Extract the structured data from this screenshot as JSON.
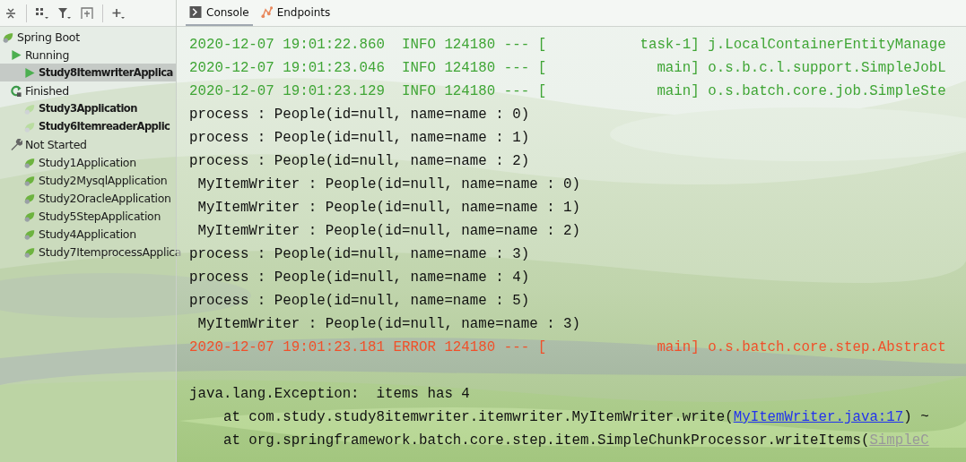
{
  "tree": {
    "label": "Spring Boot",
    "children": [
      {
        "label": "Running",
        "kind": "running",
        "children": [
          {
            "label": "Study8ItemwriterApplica",
            "bold": true,
            "selected": true
          }
        ]
      },
      {
        "label": "Finished",
        "kind": "finished",
        "children": [
          {
            "label": "Study3Application",
            "bold": true,
            "selected": false
          },
          {
            "label": "Study6ItemreaderApplic",
            "bold": true,
            "selected": false
          }
        ]
      },
      {
        "label": "Not Started",
        "kind": "not_started",
        "children": [
          {
            "label": "Study1Application",
            "bold": false,
            "selected": false
          },
          {
            "label": "Study2MysqlApplication",
            "bold": false,
            "selected": false
          },
          {
            "label": "Study2OracleApplication",
            "bold": false,
            "selected": false
          },
          {
            "label": "Study5StepApplication",
            "bold": false,
            "selected": false
          },
          {
            "label": "Study4Application",
            "bold": false,
            "selected": false
          },
          {
            "label": "Study7ItemprocessApplica",
            "bold": false,
            "selected": false
          }
        ]
      }
    ]
  },
  "tabs": [
    {
      "label": "Console",
      "kind": "console",
      "selected": true
    },
    {
      "label": "Endpoints",
      "kind": "endpoints",
      "selected": false
    }
  ],
  "console": [
    {
      "segments": [
        {
          "kind": "info",
          "text": "2020-12-07 19:01:22.860  INFO 124180 --- [           task-1] j.LocalContainerEntityManage"
        }
      ]
    },
    {
      "segments": [
        {
          "kind": "info",
          "text": "2020-12-07 19:01:23.046  INFO 124180 --- [             main] o.s.b.c.l.support.SimpleJobL"
        }
      ]
    },
    {
      "segments": [
        {
          "kind": "info",
          "text": "2020-12-07 19:01:23.129  INFO 124180 --- [             main] o.s.batch.core.job.SimpleSte"
        }
      ]
    },
    {
      "segments": [
        {
          "kind": "plain",
          "text": "process : People(id=null, name=name : 0)"
        }
      ]
    },
    {
      "segments": [
        {
          "kind": "plain",
          "text": "process : People(id=null, name=name : 1)"
        }
      ]
    },
    {
      "segments": [
        {
          "kind": "plain",
          "text": "process : People(id=null, name=name : 2)"
        }
      ]
    },
    {
      "segments": [
        {
          "kind": "plain",
          "text": " MyItemWriter : People(id=null, name=name : 0)"
        }
      ]
    },
    {
      "segments": [
        {
          "kind": "plain",
          "text": " MyItemWriter : People(id=null, name=name : 1)"
        }
      ]
    },
    {
      "segments": [
        {
          "kind": "plain",
          "text": " MyItemWriter : People(id=null, name=name : 2)"
        }
      ]
    },
    {
      "segments": [
        {
          "kind": "plain",
          "text": "process : People(id=null, name=name : 3)"
        }
      ]
    },
    {
      "segments": [
        {
          "kind": "plain",
          "text": "process : People(id=null, name=name : 4)"
        }
      ]
    },
    {
      "segments": [
        {
          "kind": "plain",
          "text": "process : People(id=null, name=name : 5)"
        }
      ]
    },
    {
      "segments": [
        {
          "kind": "plain",
          "text": " MyItemWriter : People(id=null, name=name : 3)"
        }
      ]
    },
    {
      "segments": [
        {
          "kind": "error",
          "text": "2020-12-07 19:01:23.181 ERROR 124180 --- [             main] o.s.batch.core.step.Abstract"
        }
      ]
    },
    {
      "kind": "blank"
    },
    {
      "segments": [
        {
          "kind": "plain",
          "text": "java.lang.Exception:  items has 4"
        }
      ]
    },
    {
      "segments": [
        {
          "kind": "plain",
          "text": "\tat com.study.study8itemwriter.itemwriter.MyItemWriter.write("
        },
        {
          "kind": "link",
          "text": "MyItemWriter.java:17"
        },
        {
          "kind": "plain",
          "text": ") ~"
        }
      ]
    },
    {
      "segments": [
        {
          "kind": "plain",
          "text": "\tat org.springframework.batch.core.step.item.SimpleChunkProcessor.writeItems("
        },
        {
          "kind": "muted_link",
          "text": "SimpleC"
        }
      ]
    }
  ]
}
